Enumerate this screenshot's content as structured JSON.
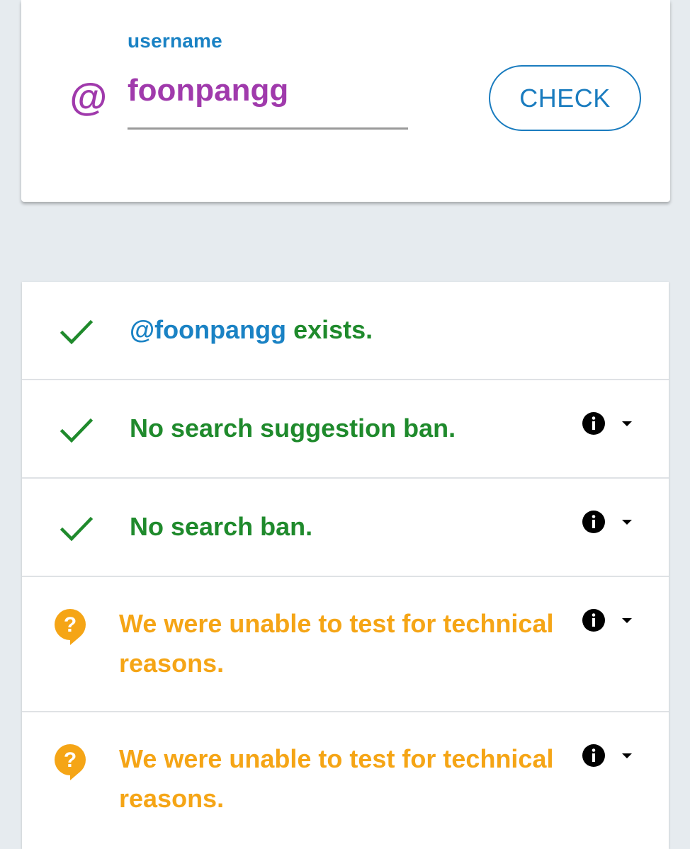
{
  "form": {
    "username_label": "username",
    "username_value": "foonpangg",
    "at_symbol": "@",
    "check_button": "CHECK"
  },
  "results": {
    "exists": {
      "handle": "@foonpangg",
      "text": "exists."
    },
    "rows": [
      {
        "text": "No search suggestion ban.",
        "status": "ok"
      },
      {
        "text": "No search ban.",
        "status": "ok"
      },
      {
        "text": "We were unable to test for technical reasons.",
        "status": "unknown"
      },
      {
        "text": "We were unable to test for technical reasons.",
        "status": "unknown"
      }
    ]
  },
  "colors": {
    "accent_blue": "#1a82c4",
    "purple": "#a03aac",
    "success_green": "#1f8a2c",
    "warning_orange": "#f5a516"
  },
  "icons": {
    "ok": "check-icon",
    "unknown": "question-bubble-icon",
    "info": "info-icon",
    "expand": "caret-down-icon"
  }
}
